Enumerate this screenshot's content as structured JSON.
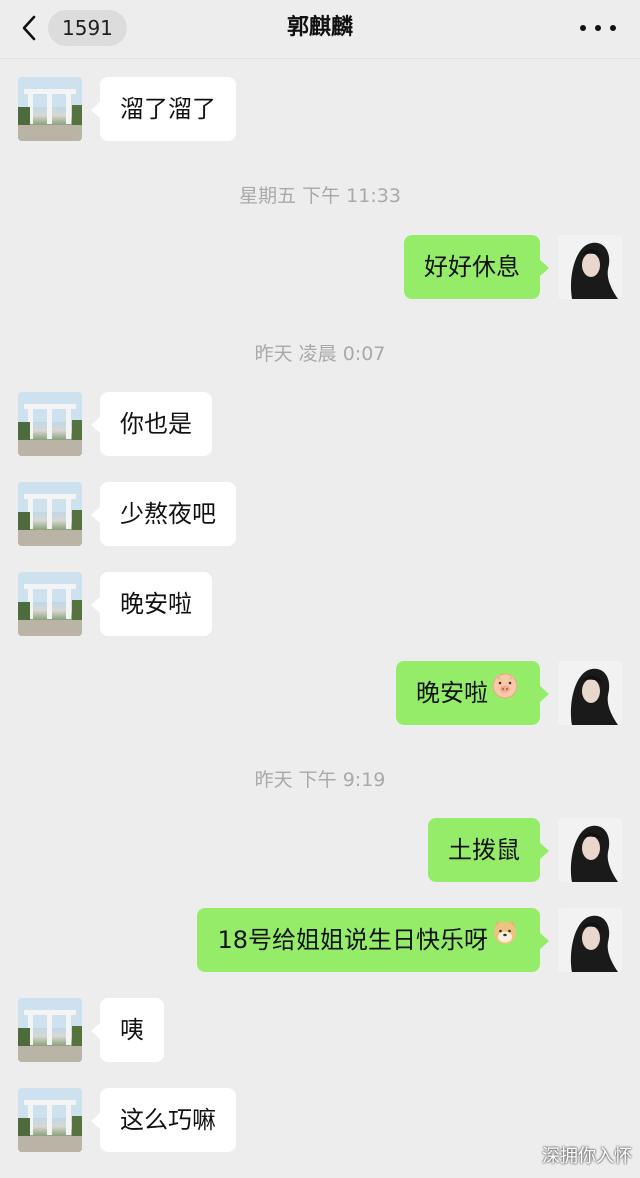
{
  "header": {
    "back_count": "1591",
    "title": "郭麒麟"
  },
  "messages": [
    {
      "text": "溜了溜了"
    },
    {
      "text": "好好休息"
    },
    {
      "text": "你也是"
    },
    {
      "text": "少熬夜吧"
    },
    {
      "text": "晚安啦"
    },
    {
      "text": "晚安啦"
    },
    {
      "text": "土拨鼠"
    },
    {
      "text": "18号给姐姐说生日快乐呀"
    },
    {
      "text": "咦"
    },
    {
      "text": "这么巧嘛"
    }
  ],
  "timestamps": [
    {
      "text": "星期五 下午 11:33"
    },
    {
      "text": "昨天 凌晨 0:07"
    },
    {
      "text": "昨天 下午 9:19"
    }
  ],
  "watermark": "深拥你入怀",
  "icons": {
    "back": "chevron-left-icon",
    "more": "more-dots-icon",
    "pig_emoji": "pig-face-emoji",
    "dog_emoji": "dog-face-emoji"
  },
  "colors": {
    "background": "#ededed",
    "bubble_self": "#95ec69",
    "bubble_other": "#ffffff",
    "timestamp": "#a9a9a9"
  }
}
